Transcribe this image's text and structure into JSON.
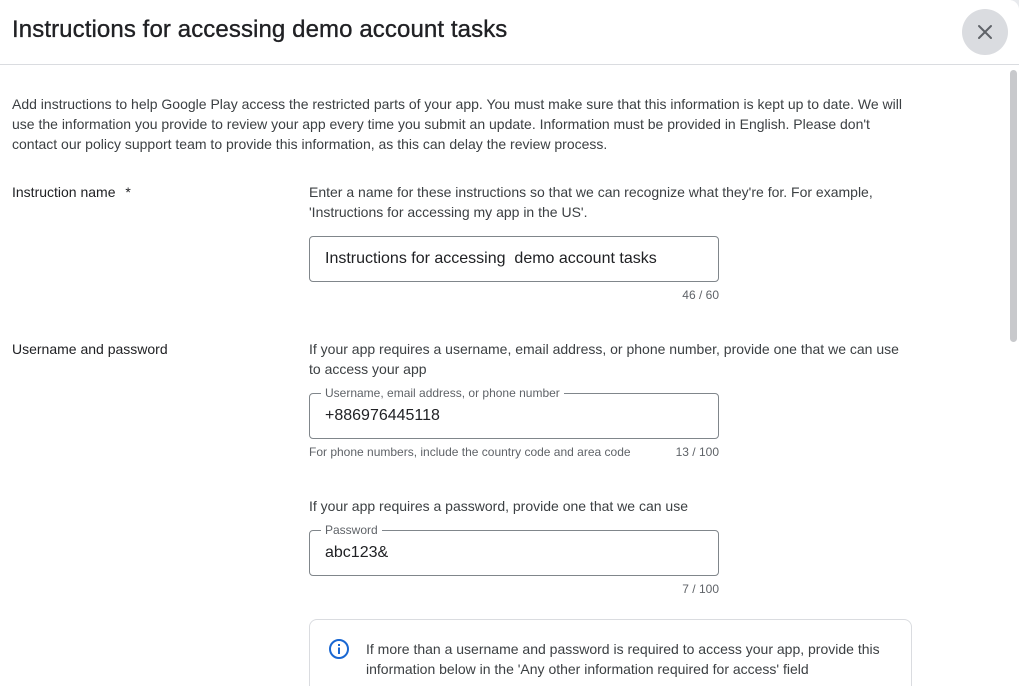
{
  "dialog": {
    "title": "Instructions for accessing demo account tasks",
    "close_icon": "close-icon"
  },
  "intro": "Add instructions to help Google Play access the restricted parts of your app. You must make sure that this information is kept up to date. We will use the information you provide to review your app every time you submit an update. Information must be provided in English. Please don't contact our policy support team to provide this information, as this can delay the review process.",
  "instruction_name": {
    "label": "Instruction name",
    "required_mark": "*",
    "description": "Enter a name for these instructions so that we can recognize what they're for. For example, 'Instructions for accessing my app in the US'.",
    "value": "Instructions for accessing  demo account tasks",
    "counter": "46 / 60"
  },
  "credentials": {
    "label": "Username and password",
    "username_description": "If your app requires a username, email address, or phone number, provide one that we can use to access your app",
    "username_label": "Username, email address, or phone number",
    "username_value": "+886976445118",
    "username_hint": "For phone numbers, include the country code and area code",
    "username_counter": "13 / 100",
    "password_description": "If your app requires a password, provide one that we can use",
    "password_label": "Password",
    "password_value": "abc123&",
    "password_counter": "7 / 100"
  },
  "info": {
    "icon": "info-icon",
    "text": "If more than a username and password is required to access your app, provide this information below in the 'Any other information required for access' field"
  },
  "colors": {
    "accent": "#1a73e8",
    "info_icon": "#1967d2",
    "border": "#80868b",
    "divider": "#dadce0"
  }
}
